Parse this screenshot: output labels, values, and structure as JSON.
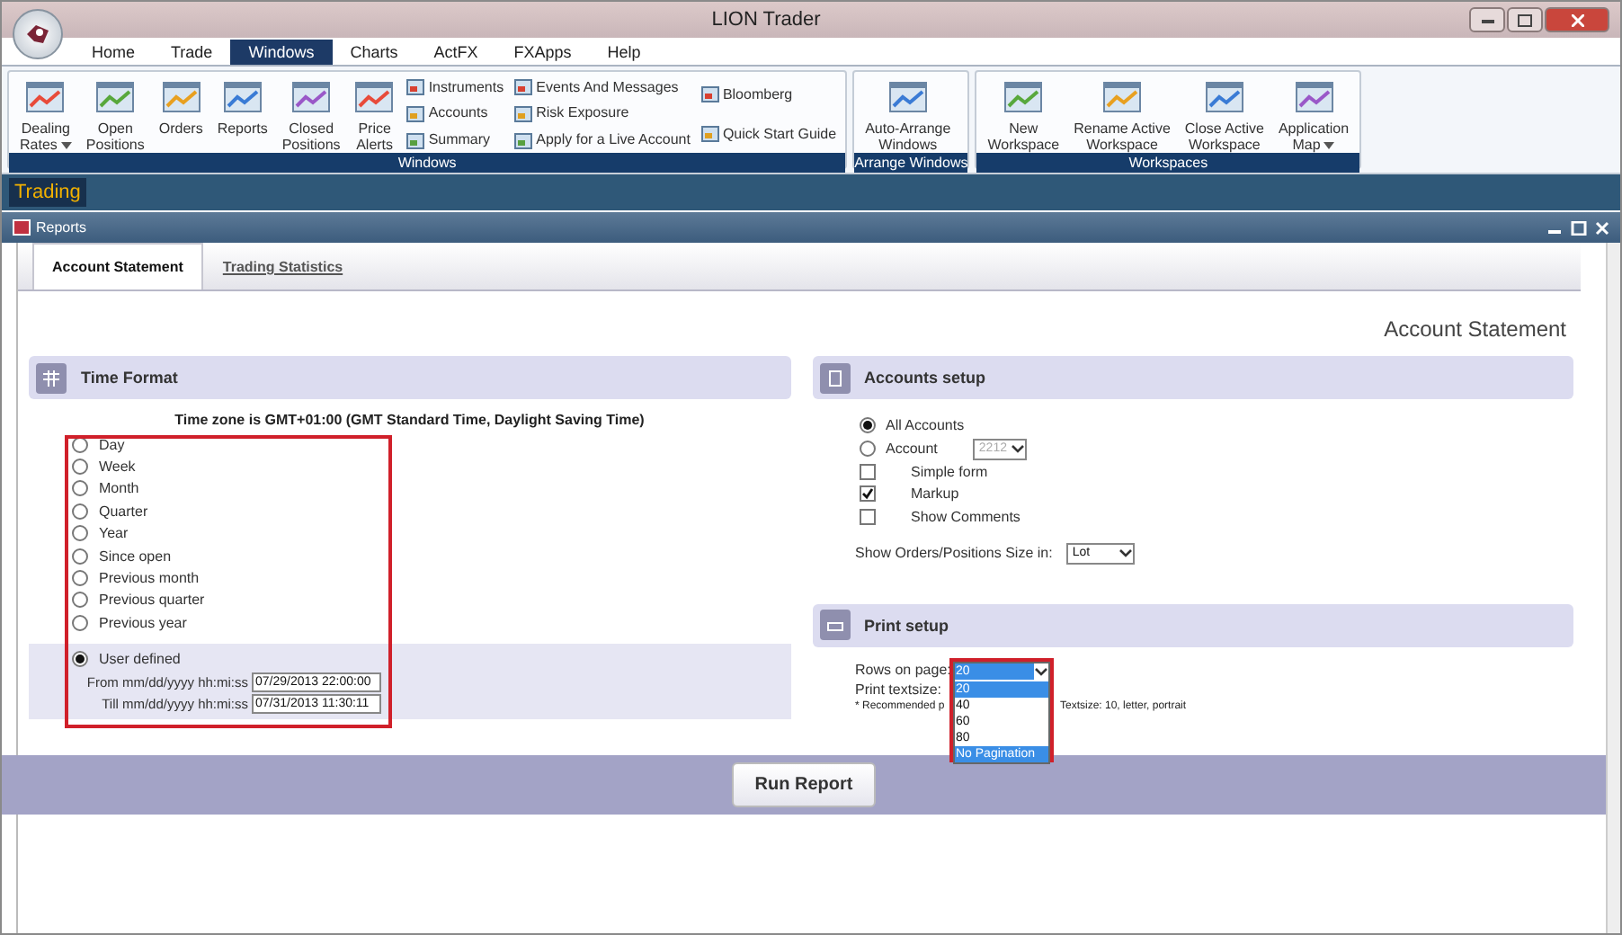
{
  "window": {
    "title": "LION Trader"
  },
  "menu_tabs": [
    {
      "label": "Home",
      "selected": false
    },
    {
      "label": "Trade",
      "selected": false
    },
    {
      "label": "Windows",
      "selected": true
    },
    {
      "label": "Charts",
      "selected": false
    },
    {
      "label": "ActFX",
      "selected": false
    },
    {
      "label": "FXApps",
      "selected": false
    },
    {
      "label": "Help",
      "selected": false
    }
  ],
  "ribbon_groups": [
    {
      "title": "Windows",
      "items": [
        {
          "kind": "large",
          "label": "Dealing\nRates",
          "dropdown": true
        },
        {
          "kind": "large",
          "label": "Open\nPositions",
          "dropdown": false
        },
        {
          "kind": "large",
          "label": "Orders",
          "dropdown": false
        },
        {
          "kind": "large",
          "label": "Reports",
          "dropdown": false
        },
        {
          "kind": "large",
          "label": "Closed\nPositions",
          "dropdown": false
        },
        {
          "kind": "large",
          "label": "Price\nAlerts",
          "dropdown": false
        },
        {
          "kind": "stack",
          "entries": [
            "Instruments",
            "Accounts",
            "Summary"
          ]
        },
        {
          "kind": "stack",
          "entries": [
            "Events And Messages",
            "Risk Exposure",
            "Apply for a Live Account"
          ]
        },
        {
          "kind": "stack",
          "entries": [
            "Bloomberg",
            "Quick Start Guide"
          ]
        }
      ]
    },
    {
      "title": "Arrange Windows",
      "items": [
        {
          "kind": "large",
          "label": "Auto-Arrange\nWindows",
          "dropdown": false
        }
      ]
    },
    {
      "title": "Workspaces",
      "items": [
        {
          "kind": "large",
          "label": "New\nWorkspace",
          "dropdown": false
        },
        {
          "kind": "large",
          "label": "Rename Active\nWorkspace",
          "dropdown": false
        },
        {
          "kind": "large",
          "label": "Close Active\nWorkspace",
          "dropdown": false
        },
        {
          "kind": "large",
          "label": "Application\nMap",
          "dropdown": true
        }
      ]
    }
  ],
  "workspace_tab": "Trading",
  "panel": {
    "title": "Reports"
  },
  "report_tabs": [
    {
      "label": "Account Statement",
      "selected": true
    },
    {
      "label": "Trading Statistics",
      "selected": false
    }
  ],
  "page_title": "Account Statement",
  "time_format": {
    "title": "Time Format",
    "timezone_note": "Time zone is GMT+01:00 (GMT Standard Time, Daylight Saving Time)",
    "options": [
      {
        "label": "Day",
        "selected": false
      },
      {
        "label": "Week",
        "selected": false
      },
      {
        "label": "Month",
        "selected": false
      },
      {
        "label": "Quarter",
        "selected": false
      },
      {
        "label": "Year",
        "selected": false
      },
      {
        "label": "Since open",
        "selected": false
      },
      {
        "label": "Previous month",
        "selected": false
      },
      {
        "label": "Previous quarter",
        "selected": false
      },
      {
        "label": "Previous year",
        "selected": false
      }
    ],
    "user_defined": {
      "label": "User defined",
      "selected": true
    },
    "from": {
      "label": "From mm/dd/yyyy hh:mi:ss",
      "value": "07/29/2013 22:00:00"
    },
    "till": {
      "label": "Till mm/dd/yyyy hh:mi:ss",
      "value": "07/31/2013 11:30:11"
    }
  },
  "accounts_setup": {
    "title": "Accounts setup",
    "options": [
      {
        "kind": "radio",
        "label": "All Accounts",
        "selected": true
      },
      {
        "kind": "radio",
        "label": "Account",
        "selected": false,
        "account": "2212"
      },
      {
        "kind": "checkbox",
        "label": "Simple form",
        "checked": false
      },
      {
        "kind": "checkbox",
        "label": "Markup",
        "checked": true
      },
      {
        "kind": "checkbox",
        "label": "Show Comments",
        "checked": false
      }
    ],
    "size_in": {
      "label": "Show Orders/Positions Size in:",
      "value": "Lot"
    }
  },
  "print_setup": {
    "title": "Print setup",
    "rows_on_page": {
      "label": "Rows on page:",
      "value": "20",
      "options": [
        {
          "label": "20",
          "highlighted": true
        },
        {
          "label": "40",
          "highlighted": false
        },
        {
          "label": "60",
          "highlighted": false
        },
        {
          "label": "80",
          "highlighted": false
        },
        {
          "label": "No Pagination",
          "highlighted": true
        }
      ]
    },
    "textsize_label": "Print textsize:",
    "note_start": "* Recommended p",
    "note_end": "Textsize: 10, letter, portrait"
  },
  "run_button": "Run Report"
}
